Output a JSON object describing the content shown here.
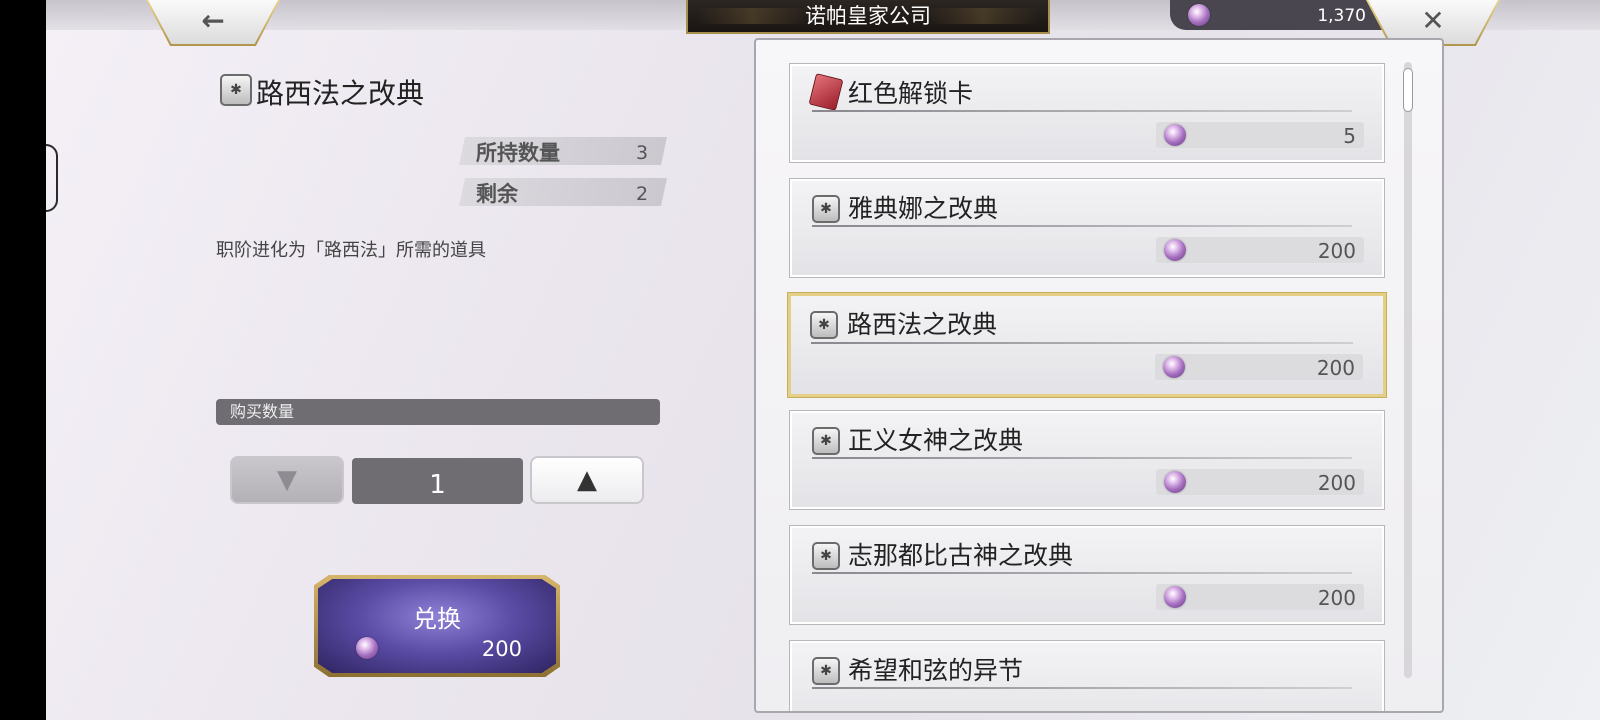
{
  "header": {
    "back_icon": "arrow-left-icon",
    "title": "诺帕皇家公司",
    "currency_amount": "1,370",
    "currency_icon": "gem-icon",
    "close_icon": "close-icon"
  },
  "detail": {
    "item_name": "路西法之改典",
    "owned_label": "所持数量",
    "owned_value": "3",
    "remaining_label": "剩余",
    "remaining_value": "2",
    "description": "职阶进化为「路西法」所需的道具"
  },
  "purchase": {
    "quantity_label": "购买数量",
    "quantity_value": "1",
    "decrement_icon": "triangle-down-icon",
    "increment_icon": "triangle-up-icon",
    "exchange_label": "兑换",
    "exchange_cost": "200"
  },
  "shop_list": {
    "selected_index": 2,
    "items": [
      {
        "name": "红色解锁卡",
        "price": "5",
        "icon": "red-card-icon"
      },
      {
        "name": "雅典娜之改典",
        "price": "200",
        "icon": "book-icon"
      },
      {
        "name": "路西法之改典",
        "price": "200",
        "icon": "book-icon"
      },
      {
        "name": "正义女神之改典",
        "price": "200",
        "icon": "book-icon"
      },
      {
        "name": "志那都比古神之改典",
        "price": "200",
        "icon": "book-icon"
      },
      {
        "name": "希望和弦的异节",
        "price": "",
        "icon": "book-icon"
      }
    ]
  },
  "colors": {
    "gold_accent": "#e4cf86",
    "exchange_purple": "#5b4ca6",
    "dark_plate": "#1a1512"
  }
}
